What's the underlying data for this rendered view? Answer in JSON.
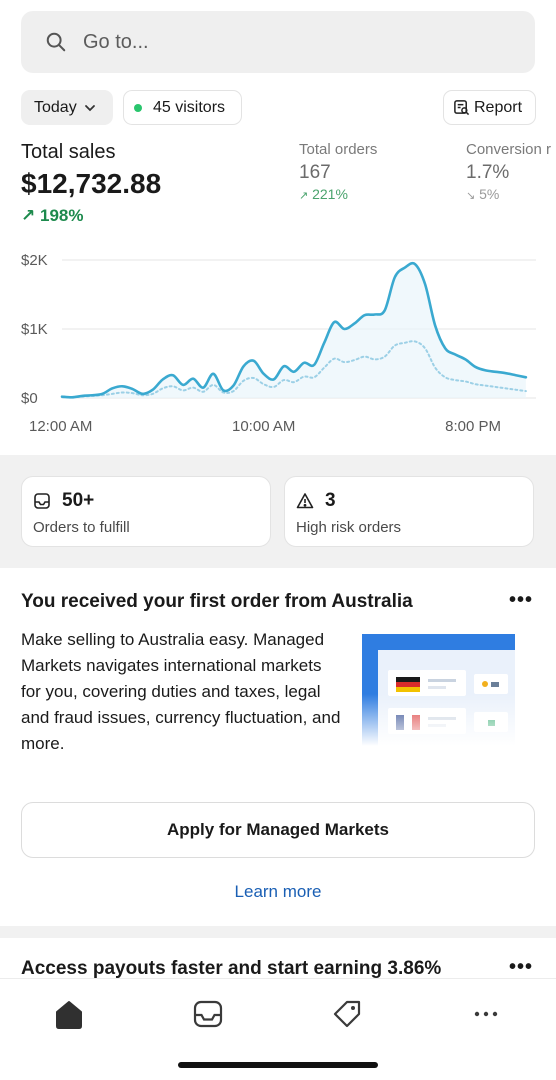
{
  "search": {
    "placeholder": "Go to..."
  },
  "filters": {
    "date_range": "Today",
    "visitors": "45 visitors",
    "report_label": "Report"
  },
  "metrics": {
    "total_sales": {
      "label": "Total sales",
      "value": "$12,732.88",
      "change": "198%",
      "direction": "up"
    },
    "total_orders": {
      "label": "Total orders",
      "value": "167",
      "change": "221%",
      "direction": "up"
    },
    "conversion": {
      "label": "Conversion r",
      "value": "1.7%",
      "change": "5%",
      "direction": "down"
    }
  },
  "chart_data": {
    "type": "line",
    "title": "",
    "xlabel": "",
    "ylabel": "",
    "y_tick_labels": [
      "$0",
      "$1K",
      "$2K"
    ],
    "x_tick_labels": [
      "12:00 AM",
      "10:00 AM",
      "8:00 PM"
    ],
    "ylim": [
      0,
      2000
    ],
    "grid": true,
    "x_hours": [
      0,
      0.5,
      1,
      1.5,
      2,
      2.5,
      3,
      3.5,
      4,
      4.5,
      5,
      5.5,
      6,
      6.5,
      7,
      7.5,
      8,
      8.5,
      9,
      9.5,
      10,
      10.5,
      11,
      11.5,
      12,
      12.5,
      13,
      13.5,
      14,
      14.5,
      15,
      15.5,
      16,
      16.5,
      17,
      17.5,
      18,
      18.5,
      19,
      19.5,
      20,
      20.5,
      21,
      21.5,
      22,
      22.5,
      23
    ],
    "series": [
      {
        "style": "solid",
        "values": [
          20,
          10,
          30,
          40,
          60,
          140,
          170,
          130,
          60,
          120,
          270,
          330,
          190,
          280,
          150,
          350,
          110,
          180,
          460,
          540,
          350,
          270,
          460,
          380,
          510,
          480,
          800,
          1100,
          1000,
          1080,
          1200,
          1210,
          1270,
          1750,
          1890,
          1940,
          1650,
          1050,
          720,
          630,
          560,
          450,
          400,
          380,
          360,
          330,
          300
        ]
      },
      {
        "style": "dotted",
        "values": [
          10,
          10,
          20,
          30,
          40,
          60,
          80,
          70,
          40,
          60,
          140,
          170,
          110,
          150,
          90,
          190,
          80,
          100,
          250,
          290,
          200,
          160,
          260,
          230,
          310,
          300,
          440,
          570,
          520,
          550,
          600,
          560,
          600,
          760,
          800,
          820,
          720,
          440,
          300,
          260,
          240,
          200,
          180,
          160,
          140,
          120,
          100
        ]
      }
    ],
    "colors": {
      "solid": "#3aa9d0",
      "dotted": "#9cd0e6",
      "grid": "#e6e6e6"
    }
  },
  "cards": [
    {
      "icon": "inbox-icon",
      "value": "50+",
      "label": "Orders to fulfill"
    },
    {
      "icon": "alert-triangle-icon",
      "value": "3",
      "label": "High risk orders"
    }
  ],
  "promo": {
    "title": "You received your first order from Australia",
    "body": "Make selling to Australia easy. Managed Markets navigates international markets for you, covering duties and taxes, legal and fraud issues, currency fluctuation, and more.",
    "cta_label": "Apply for Managed Markets",
    "link_label": "Learn more"
  },
  "next_card": {
    "title": "Access payouts faster and start earning 3.86%"
  },
  "tabbar": {
    "items": [
      "home-icon",
      "orders-icon",
      "products-icon",
      "more-icon"
    ]
  }
}
